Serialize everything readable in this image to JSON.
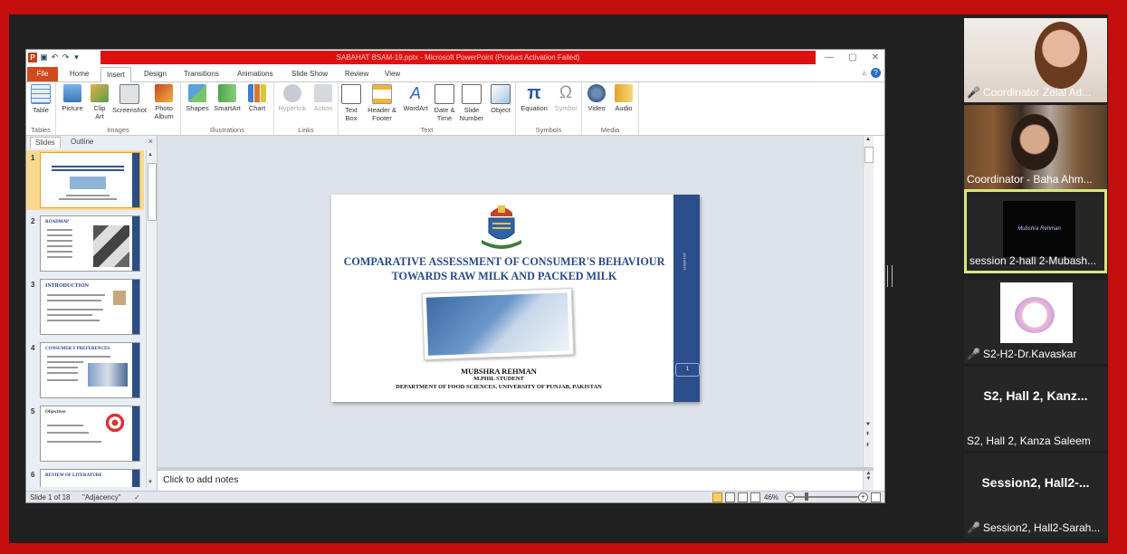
{
  "window": {
    "title": "SABAHAT BSAM-19.pptx  -  Microsoft PowerPoint (Product Activation Failed)",
    "controls": [
      "—",
      "▢",
      "✕"
    ]
  },
  "ribbon": {
    "tabs": [
      "File",
      "Home",
      "Insert",
      "Design",
      "Transitions",
      "Animations",
      "Slide Show",
      "Review",
      "View"
    ],
    "active_tab": "Insert",
    "groups": [
      {
        "label": "Tables",
        "buttons": [
          "Table"
        ]
      },
      {
        "label": "Images",
        "buttons": [
          "Picture",
          "Clip Art",
          "Screenshot",
          "Photo Album"
        ]
      },
      {
        "label": "Illustrations",
        "buttons": [
          "Shapes",
          "SmartArt",
          "Chart"
        ]
      },
      {
        "label": "Links",
        "buttons": [
          "Hyperlink",
          "Action"
        ]
      },
      {
        "label": "Text",
        "buttons": [
          "Text Box",
          "Header & Footer",
          "WordArt",
          "Date & Time",
          "Slide Number",
          "Object"
        ]
      },
      {
        "label": "Symbols",
        "buttons": [
          "Equation",
          "Symbol"
        ]
      },
      {
        "label": "Media",
        "buttons": [
          "Video",
          "Audio"
        ]
      }
    ]
  },
  "slides_panel": {
    "tabs": [
      "Slides",
      "Outline"
    ],
    "close": "×",
    "thumbnails": [
      {
        "num": "1",
        "title": ""
      },
      {
        "num": "2",
        "title": "ROADMAP"
      },
      {
        "num": "3",
        "title": "INTRODUCTION"
      },
      {
        "num": "4",
        "title": "CONSUMER'S PREFERENCES"
      },
      {
        "num": "5",
        "title": "Objectives"
      },
      {
        "num": "6",
        "title": "REVIEW OF LITERATURE"
      }
    ]
  },
  "slide": {
    "title": "COMPARATIVE ASSESSMENT OF CONSUMER'S BEHAVIOUR TOWARDS RAW MILK AND PACKED MILK",
    "presenter": "MUBSHRA REHMAN",
    "role": "M.PHIL STUDENT",
    "department": "DEPARTMENT OF FOOD SCIENCES, UNIVERSITY OF PUNJAB, PAKISTAN",
    "page": "1",
    "date": "11/14/2021"
  },
  "notes": {
    "placeholder": "Click to add notes"
  },
  "status": {
    "slide": "Slide 1 of 18",
    "theme": "\"Adjacency\"",
    "zoom": "46%"
  },
  "participants": [
    {
      "name": "Coordinator Zelal Ad...",
      "muted": true
    },
    {
      "name": "Coordinator - Baha Ahm...",
      "muted": false
    },
    {
      "name": "session 2-hall 2-Mubash...",
      "muted": false,
      "active": true,
      "label": "Mubshra Rehman"
    },
    {
      "name": "S2-H2-Dr.Kavaskar",
      "muted": true
    },
    {
      "name": "S2, Hall 2, Kanza Saleem",
      "muted": false,
      "big": "S2, Hall 2, Kanz..."
    },
    {
      "name": "Session2, Hall2-Sarah...",
      "muted": true,
      "big": "Session2,  Hall2-..."
    }
  ]
}
